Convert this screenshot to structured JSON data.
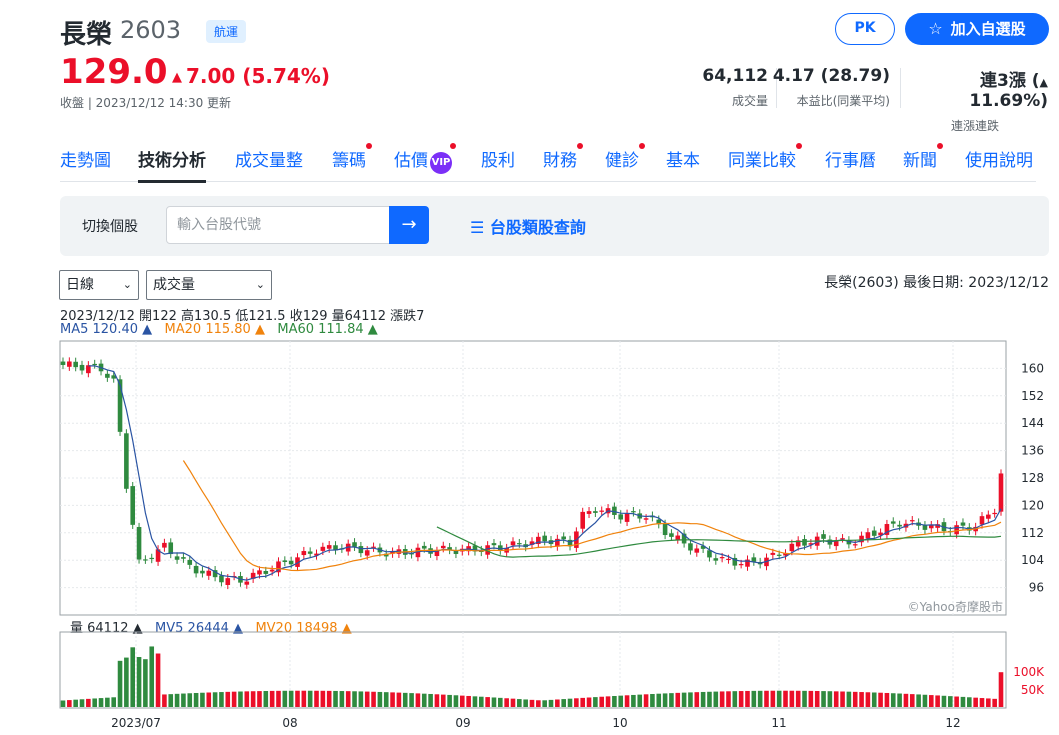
{
  "stock": {
    "name": "長榮",
    "code": "2603",
    "industry": "航運",
    "price": "129.0",
    "change": "7.00 (5.74%)",
    "status": "收盤 | 2023/12/12 14:30 更新"
  },
  "actions": {
    "pk": "PK",
    "add": "加入自選股"
  },
  "stats": [
    {
      "value": "64,112",
      "label": "成交量"
    },
    {
      "value": "4.17 (28.79)",
      "label": "本益比(同業平均)"
    },
    {
      "value": "連3漲 (",
      "value2": "11.69%)",
      "label": "連漲連跌"
    }
  ],
  "nav": [
    {
      "label": "走勢圖"
    },
    {
      "label": "技術分析"
    },
    {
      "label": "成交量整"
    },
    {
      "label": "籌碼"
    },
    {
      "label": "估價"
    },
    {
      "label": "股利"
    },
    {
      "label": "財務"
    },
    {
      "label": "健診"
    },
    {
      "label": "基本"
    },
    {
      "label": "同業比較"
    },
    {
      "label": "行事曆"
    },
    {
      "label": "新聞"
    },
    {
      "label": "使用說明"
    }
  ],
  "vip": "VIP",
  "search": {
    "label": "切換個股",
    "placeholder": "輸入台股代號",
    "link": "台股類股查詢"
  },
  "selects": {
    "period": "日線",
    "indicator": "成交量"
  },
  "chart_header": "長榮(2603)   最後日期: 2023/12/12",
  "ohlc_line": "2023/12/12 開122 高130.5 低121.5 收129 量64112 漲跌7",
  "ma": {
    "ma5": "MA5 120.40 ▲",
    "ma20": "MA20 115.80 ▲",
    "ma60": "MA60 111.84 ▲"
  },
  "vol": {
    "v": "量 64112 ▲",
    "mv5": "MV5 26444 ▲",
    "mv20": "MV20 18498 ▲"
  },
  "watermark": "©Yahoo奇摩股市",
  "chart_data": {
    "type": "candlestick",
    "yticks": [
      "160",
      "152",
      "144",
      "136",
      "128",
      "120",
      "112",
      "104",
      "96"
    ],
    "vol_ticks": [
      "100K",
      "50K"
    ],
    "xticks": [
      "2023/07",
      "08",
      "09",
      "10",
      "11",
      "12"
    ],
    "last": {
      "date": "2023/12/12",
      "open": 122,
      "high": 130.5,
      "low": 121.5,
      "close": 129,
      "volume": 64112
    },
    "colors": {
      "up": "#eb0f29",
      "down": "#2f8a3f",
      "ma5": "#2a54a3",
      "ma20": "#f0830d",
      "ma60": "#2f8a3f"
    }
  }
}
